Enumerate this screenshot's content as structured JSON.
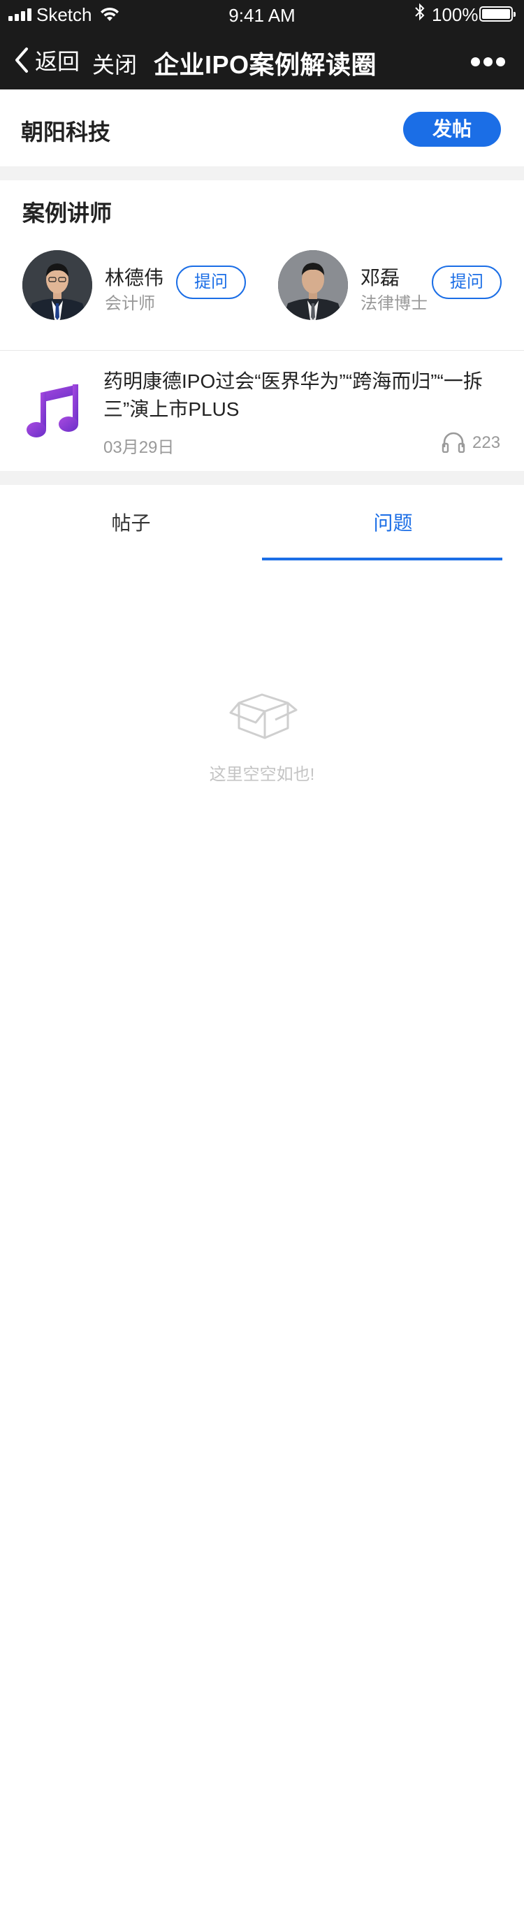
{
  "status_bar": {
    "carrier": "Sketch",
    "time": "9:41 AM",
    "battery": "100%"
  },
  "nav": {
    "back_label": "返回",
    "close_label": "关闭",
    "title": "企业IPO案例解读圈"
  },
  "company": {
    "name": "朝阳科技",
    "post_button": "发帖"
  },
  "lecturers": {
    "title": "案例讲师",
    "items": [
      {
        "name": "林德伟",
        "role": "会计师",
        "ask_label": "提问"
      },
      {
        "name": "邓磊",
        "role": "法律博士",
        "ask_label": "提问"
      }
    ]
  },
  "audio": {
    "title": "药明康德IPO过会“医界华为”“跨海而归”“一拆三”演上市PLUS",
    "date": "03月29日",
    "listens": "223"
  },
  "tabs": {
    "items": [
      {
        "label": "帖子"
      },
      {
        "label": "问题"
      }
    ],
    "active": "问题"
  },
  "empty_state": {
    "text": "这里空空如也!"
  },
  "colors": {
    "accent": "#1b6ee6",
    "header_bg": "#1b1b1b",
    "section_gap": "#f2f2f2"
  }
}
